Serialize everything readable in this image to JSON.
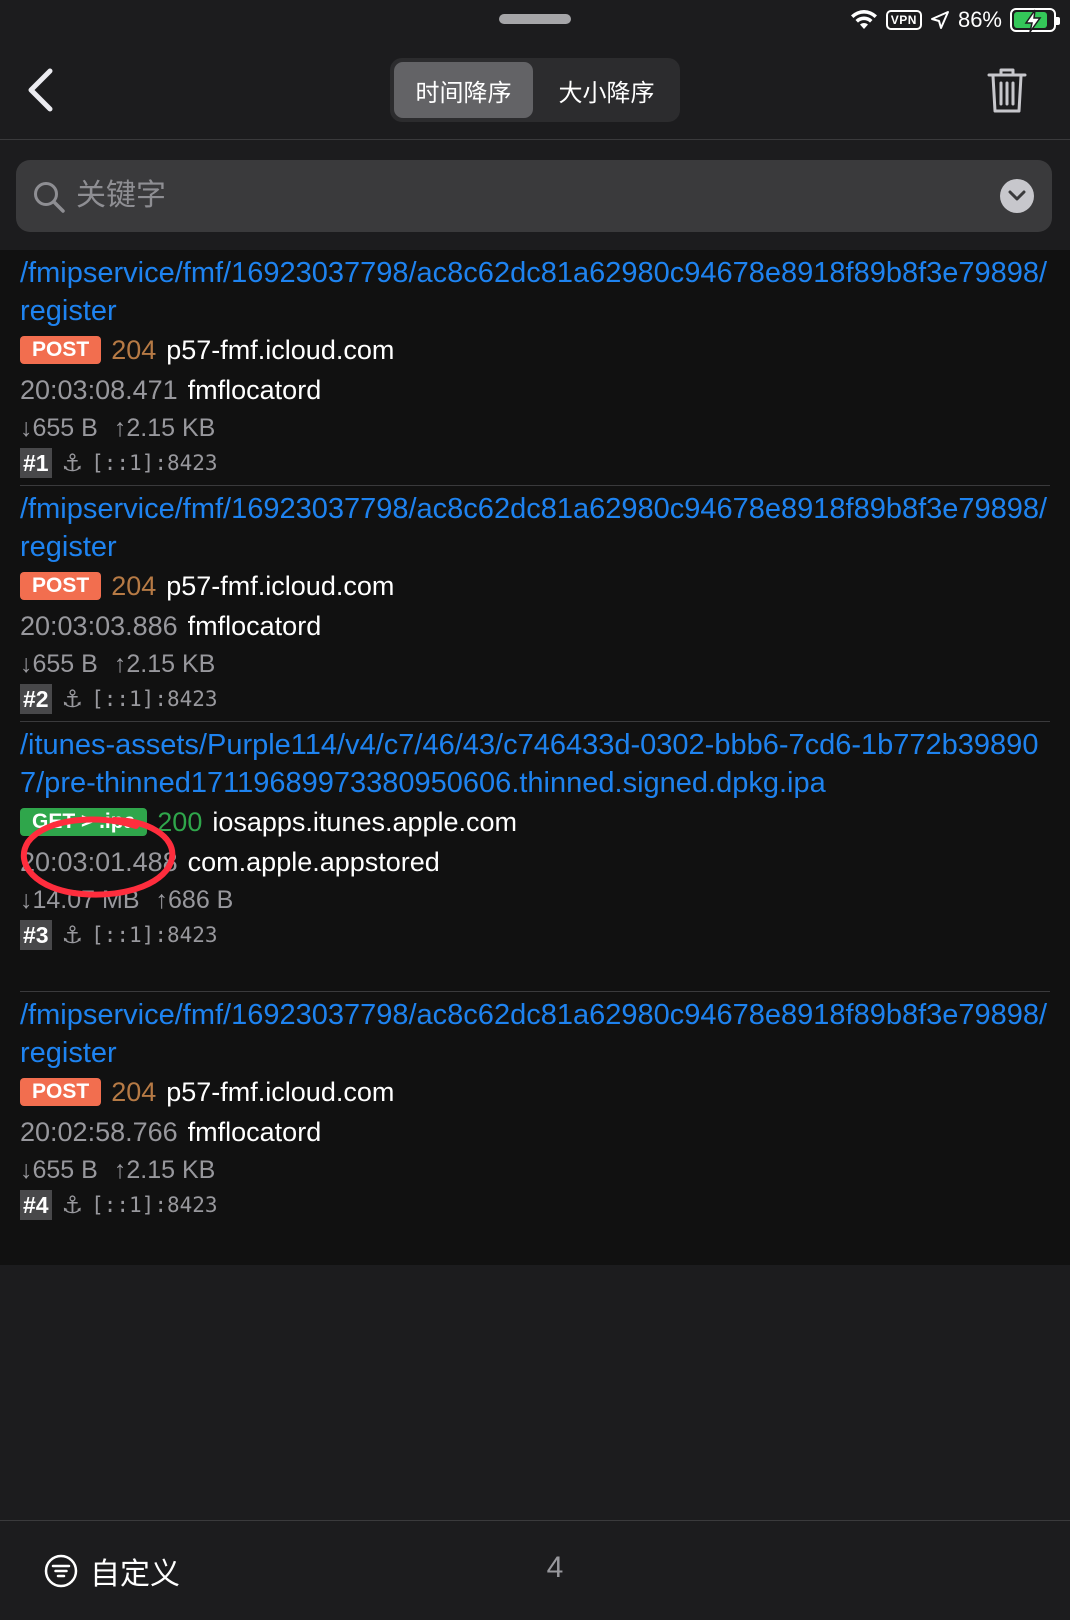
{
  "status_bar": {
    "vpn_label": "VPN",
    "battery_percent": "86%",
    "battery_level": 0.86,
    "icons": [
      "wifi-icon",
      "location-arrow-icon",
      "battery-charging-icon"
    ]
  },
  "nav": {
    "back_icon": "chevron-left-icon",
    "segments": [
      {
        "label": "时间降序",
        "active": true
      },
      {
        "label": "大小降序",
        "active": false
      }
    ],
    "trash_icon": "trash-icon"
  },
  "search": {
    "placeholder": "关键字",
    "value": ""
  },
  "colors": {
    "link": "#1e83f0",
    "post": "#f26e4f",
    "get": "#2fa64b",
    "status_204": "#b67a45",
    "status_200": "#2fa64b",
    "annotation": "#ff2d3d"
  },
  "requests": [
    {
      "path": "/fmipservice/fmf/16923037798/ac8c62dc81a62980c94678e8918f89b8f3e79898/register",
      "method": "POST",
      "status": "204",
      "host": "p57-fmf.icloud.com",
      "time": "20:03:08.471",
      "process": "fmflocatord",
      "down": "↓655 B",
      "up": "↑2.15 KB",
      "index": "#1",
      "address": "[::1]:8423"
    },
    {
      "path": "/fmipservice/fmf/16923037798/ac8c62dc81a62980c94678e8918f89b8f3e79898/register",
      "method": "POST",
      "status": "204",
      "host": "p57-fmf.icloud.com",
      "time": "20:03:03.886",
      "process": "fmflocatord",
      "down": "↓655 B",
      "up": "↑2.15 KB",
      "index": "#2",
      "address": "[::1]:8423"
    },
    {
      "path": "/itunes-assets/Purple114/v4/c7/46/43/c746433d-0302-bbb6-7cd6-1b772b398907/pre-thinned1711968997338095060​6.thinned.signed.dpkg.ipa",
      "method": "GET > .ipa",
      "status": "200",
      "host": "iosapps.itunes.apple.com",
      "time": "20:03:01.488",
      "process": "com.apple.appstored",
      "down": "↓14.07 MB",
      "up": "↑686 B",
      "index": "#3",
      "address": "[::1]:8423"
    },
    {
      "path": "/fmipservice/fmf/16923037798/ac8c62dc81a62980c94678e8918f89b8f3e79898/register",
      "method": "POST",
      "status": "204",
      "host": "p57-fmf.icloud.com",
      "time": "20:02:58.766",
      "process": "fmflocatord",
      "down": "↓655 B",
      "up": "↑2.15 KB",
      "index": "#4",
      "address": "[::1]:8423"
    }
  ],
  "bottom": {
    "customize_label": "自定义",
    "customize_icon": "filter-circle-icon",
    "count": "4"
  }
}
